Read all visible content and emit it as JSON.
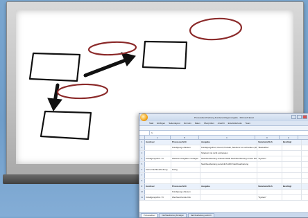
{
  "excel": {
    "title": "Prozessbeschreibung-Kundenanfragenvergabe - Microsoft Excel",
    "menu": [
      "Start",
      "Einfügen",
      "Seitenlayout",
      "Formeln",
      "Daten",
      "Überprüfen",
      "Ansicht",
      "Entwicklertools",
      "Team"
    ],
    "name_box": "",
    "formula_prefix": "fx",
    "columns": [
      "A",
      "B",
      "C",
      "D",
      "E"
    ],
    "table1": {
      "headers": [
        "Auslöser",
        "Prozessschritt",
        "Ausgabe",
        "Verantwortlich",
        "Benötigt"
      ],
      "rows": [
        [
          "",
          "Kündigung erfassen",
          "Kündigungsfrist, Grund, Produkt, Telefonnr ist vorhanden (300€)",
          "\"Backoffice\"",
          ""
        ],
        [
          "",
          "",
          "Telefonnr ist nicht vorhanden",
          "",
          ""
        ],
        [
          "Kündigungsfrist < 6",
          "Weiterer Ausgaben Vorlagen",
          "Nachbearbeitung einleiten/ADD Nachbearbeitung erneut DONE",
          "\"System\"",
          ""
        ],
        [
          "",
          "",
          "Nachbearbeitung persönlich ADD Nachbearbeitung",
          "",
          ""
        ],
        [
          "Keine Nachbearbeitung",
          "Fertig",
          "",
          "",
          ""
        ]
      ]
    },
    "table2": {
      "headers": [
        "Auslöser",
        "Prozessschritt",
        "Ausgabe",
        "Verantwortlich",
        "Benötigt"
      ],
      "rows": [
        [
          "",
          "Kündigung erfassen",
          "",
          "",
          ""
        ],
        [
          "Kündigungsfrist < 6",
          "Wechsel-Kunde Info",
          "",
          "\"System\"",
          ""
        ]
      ]
    },
    "sheet_tabs": [
      "Prozessablauf",
      "Nachbearbeitung Kündigen",
      "Nachbearbeitung verkürzt"
    ]
  }
}
